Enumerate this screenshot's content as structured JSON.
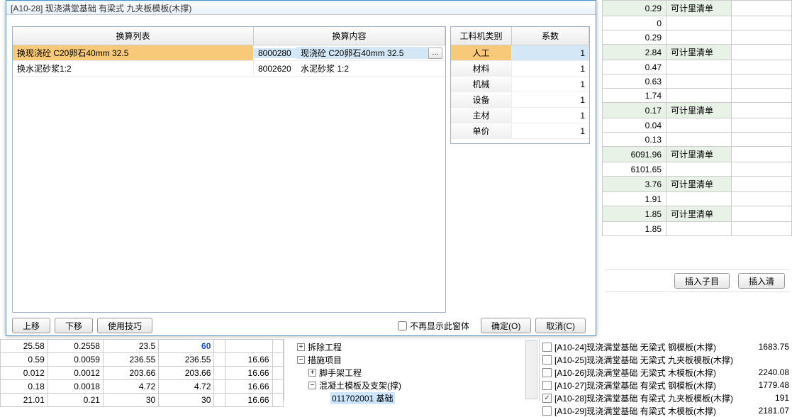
{
  "dialog": {
    "title": "[A10-28]  现浇满堂基础 有梁式 九夹板模板(木撑)",
    "left": {
      "header1": "换算列表",
      "header2": "换算内容",
      "rows": [
        {
          "name": "换现浇砼 C20卵石40mm 32.5",
          "code": "8000280",
          "content": "现浇砼 C20卵石40mm 32.5"
        },
        {
          "name": "换水泥砂浆1:2",
          "code": "8002620",
          "content": "水泥砂浆 1:2"
        }
      ],
      "more_label": "…"
    },
    "right": {
      "header1": "工料机类别",
      "header2": "系数",
      "rows": [
        {
          "type": "人工",
          "coef": "1"
        },
        {
          "type": "材料",
          "coef": "1"
        },
        {
          "type": "机械",
          "coef": "1"
        },
        {
          "type": "设备",
          "coef": "1"
        },
        {
          "type": "主材",
          "coef": "1"
        },
        {
          "type": "单价",
          "coef": "1"
        }
      ]
    },
    "footer": {
      "move_up": "上移",
      "move_down": "下移",
      "tips": "使用技巧",
      "dont_show": "不再显示此窗体",
      "ok": "确定(O)",
      "cancel": "取消(C)"
    }
  },
  "bg_rows": [
    {
      "val": "0.29",
      "txt": "可计里清单"
    },
    {
      "val": "0",
      "txt": ""
    },
    {
      "val": "0.29",
      "txt": ""
    },
    {
      "val": "2.84",
      "txt": "可计里清单"
    },
    {
      "val": "0.47",
      "txt": ""
    },
    {
      "val": "0.63",
      "txt": ""
    },
    {
      "val": "1.74",
      "txt": ""
    },
    {
      "val": "0.17",
      "txt": "可计里清单"
    },
    {
      "val": "0.04",
      "txt": ""
    },
    {
      "val": "0.13",
      "txt": ""
    },
    {
      "val": "6091.96",
      "txt": "可计里清单"
    },
    {
      "val": "6101.65",
      "txt": ""
    },
    {
      "val": "3.76",
      "txt": "可计里清单"
    },
    {
      "val": "1.91",
      "txt": ""
    },
    {
      "val": "1.85",
      "txt": "可计里清单"
    },
    {
      "val": "1.85",
      "txt": ""
    }
  ],
  "btnrow": {
    "insert_sub": "插入子目",
    "insert_list": "插入清"
  },
  "lower_grid": {
    "rows": [
      [
        "25.58",
        "0.2558",
        "23.5",
        "60",
        "",
        "",
        ""
      ],
      [
        "0.59",
        "0.0059",
        "236.55",
        "236.55",
        "",
        "16.66",
        ""
      ],
      [
        "0.012",
        "0.0012",
        "203.66",
        "203.66",
        "",
        "16.66",
        ""
      ],
      [
        "0.18",
        "0.0018",
        "4.72",
        "4.72",
        "",
        "16.66",
        ""
      ],
      [
        "21.01",
        "0.21",
        "30",
        "30",
        "",
        "16.66",
        ""
      ]
    ]
  },
  "tree": {
    "items": [
      {
        "indent": 0,
        "toggle": "▷",
        "label": "拆除工程"
      },
      {
        "indent": 0,
        "toggle": "▿",
        "label": "措施项目"
      },
      {
        "indent": 1,
        "toggle": "▷",
        "label": "脚手架工程"
      },
      {
        "indent": 1,
        "toggle": "▿",
        "label": "混凝土模板及支架(撑)"
      },
      {
        "indent": 2,
        "toggle": "",
        "label": "011702001 基础",
        "selected": true
      }
    ]
  },
  "checks": [
    {
      "checked": false,
      "code": "A10-24",
      "desc": "现浇满堂基础 无梁式 钢模板(木撑)",
      "val": "1683.75"
    },
    {
      "checked": false,
      "code": "A10-25",
      "desc": "现浇满堂基础 无梁式 九夹板模板(木撑)",
      "val": ""
    },
    {
      "checked": false,
      "code": "A10-26",
      "desc": "现浇满堂基础 无梁式 木模板(木撑)",
      "val": "2240.08"
    },
    {
      "checked": false,
      "code": "A10-27",
      "desc": "现浇满堂基础 有梁式 钢模板(木撑)",
      "val": "1779.48"
    },
    {
      "checked": true,
      "code": "A10-28",
      "desc": "现浇满堂基础 有梁式 九夹板模板(木撑)",
      "val": "191"
    },
    {
      "checked": false,
      "code": "A10-29",
      "desc": "现浇满堂基础 有梁式 木模板(木撑)",
      "val": "2181.07"
    }
  ]
}
